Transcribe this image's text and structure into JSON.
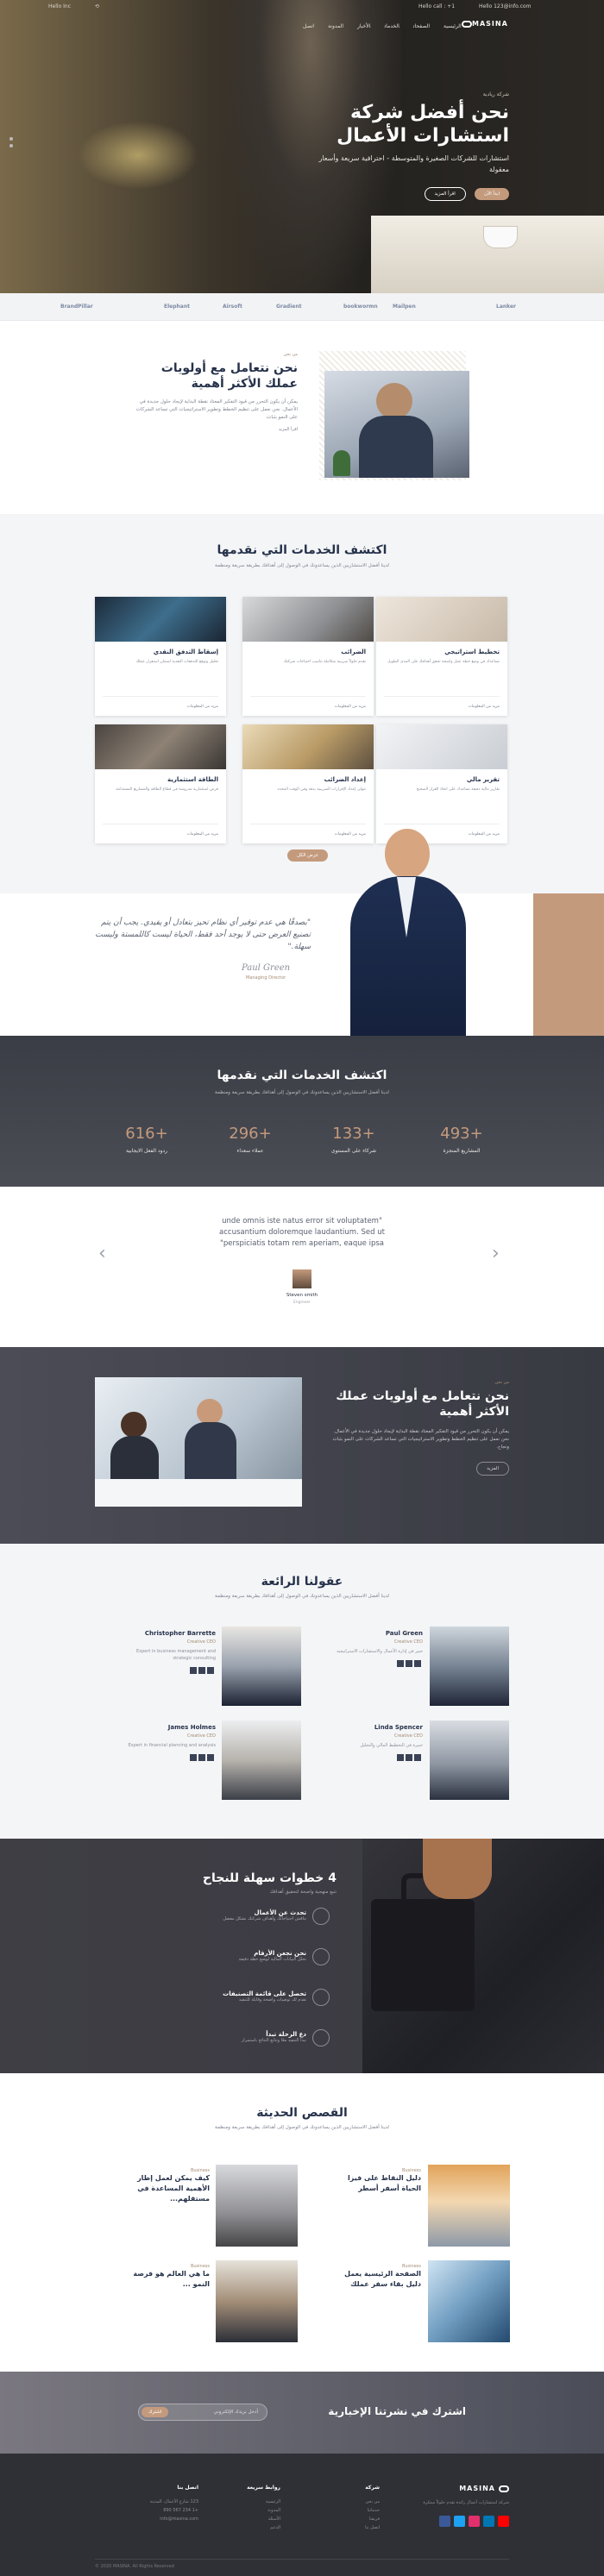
{
  "topbar": {
    "left_text": "Hello Inc",
    "phone": "Hello call : +1",
    "email": "Hello 123@info.com"
  },
  "nav": {
    "items": [
      "الرئيسية",
      "الصفحات",
      "الخدمات",
      "الأخبار",
      "المدونة",
      "اتصل"
    ]
  },
  "brand": {
    "name": "MASINA"
  },
  "hero": {
    "eyebrow": "شركة ريادية",
    "title": "نحن أفضل شركة استشارات الأعمال",
    "subtitle": "استشارات للشركات الصغيرة والمتوسطة - احترافية سريعة وأسعار معقولة",
    "btn_primary": "ابدأ الآن",
    "btn_secondary": "اقرأ المزيد"
  },
  "partners": [
    "BrandPillar",
    "Elephant",
    "Airsoft",
    "Gradient",
    "bookwormn",
    "Mailpen",
    "Lanker"
  ],
  "about": {
    "label": "من نحن",
    "title": "نحن نتعامل مع أولويات عملك الأكثر أهمية",
    "body": "يمكن أن يكون التحرر من قيود التفكير المعتاد نقطة البداية لإيجاد حلول جديدة في الأعمال. نحن نعمل على تنظيم الخطط وتطوير الاستراتيجيات التي تساعد الشركات على النمو بثبات.",
    "link": "اقرأ المزيد"
  },
  "services": {
    "title": "اكتشف الخدمات التي نقدمها",
    "intro": "لدينا أفضل الاستشاريين الذين يساعدونك في الوصول إلى أهدافك بطريقة سريعة ومنظمة",
    "cards": [
      {
        "title": "تخطيط استراتيجي",
        "desc": "نساعدك في وضع خطة عمل واضحة تحقق أهدافك على المدى الطويل",
        "more": "مزيد من المعلومات"
      },
      {
        "title": "الضرائب",
        "desc": "نقدم حلولاً ضريبية متكاملة تناسب احتياجات شركتك",
        "more": "مزيد من المعلومات"
      },
      {
        "title": "إسقاط التدفق النقدي",
        "desc": "تحليل وتوقع التدفقات النقدية لضمان استقرار عملك",
        "more": "مزيد من المعلومات"
      },
      {
        "title": "تقرير مالي",
        "desc": "تقارير مالية دقيقة تساعدك على اتخاذ القرار الصحيح",
        "more": "مزيد من المعلومات"
      },
      {
        "title": "إعداد الضرائب",
        "desc": "نتولى إعداد الإقرارات الضريبية بدقة وفي الوقت المحدد",
        "more": "مزيد من المعلومات"
      },
      {
        "title": "الطاقة استثمارية",
        "desc": "فرص استثمارية مدروسة في قطاع الطاقة والمشاريع المستدامة",
        "more": "مزيد من المعلومات"
      }
    ],
    "button": "عرض الكل"
  },
  "testimonial": {
    "quote": "\"بصدقًا هي عدم توفير أي نظام تحيز بتعادل أو يفيدي. يجب أن يتم تصنيع العرض حتى لا يوجد أحد فقط، الحياة ليست كاللمستة وليست سهلة.\"",
    "signature": "Paul Green",
    "role": "Managing Director"
  },
  "stats": {
    "title": "اكتشف الخدمات التي نقدمها",
    "intro": "لدينا أفضل الاستشاريين الذين يساعدونك في الوصول إلى أهدافك بطريقة سريعة ومنظمة",
    "items": [
      {
        "num": "493+",
        "label": "المشاريع المنجزة"
      },
      {
        "num": "133+",
        "label": "شركاء على المستوى"
      },
      {
        "num": "296+",
        "label": "عملاء سعداء"
      },
      {
        "num": "616+",
        "label": "ردود الفعل الايجابية"
      }
    ]
  },
  "quote": {
    "text": "unde omnis iste natus error sit voluptatem\" accusantium doloremque laudantium. Sed ut \"perspiciatis totam rem aperiam, eaque ipsa",
    "name": "Steven smith",
    "role": "Engineer"
  },
  "priorities": {
    "label": "من نحن",
    "title": "نحن نتعامل مع أولويات عملك الأكثر أهمية",
    "body": "يمكن أن يكون التحرر من قيود التفكير المعتاد نقطة البداية لإيجاد حلول جديدة في الأعمال. نحن نعمل على تنظيم الخطط وتطوير الاستراتيجيات التي تساعد الشركات على النمو بثبات ونجاح.",
    "button": "المزيد"
  },
  "team": {
    "title": "عقولنا الرائعة",
    "intro": "لدينا أفضل الاستشاريين الذين يساعدونك في الوصول إلى أهدافك بطريقة سريعة ومنظمة",
    "members": [
      {
        "name": "Paul Green",
        "role": "Creative CEO",
        "desc": "خبير في إدارة الأعمال والاستشارات الاستراتيجية"
      },
      {
        "name": "Christopher Barrette",
        "role": "Creative CEO",
        "desc": "Expert in business management and strategic consulting"
      },
      {
        "name": "Linda Spencer",
        "role": "Creative CEO",
        "desc": "خبيرة في التخطيط المالي والتحليل"
      },
      {
        "name": "James Holmes",
        "role": "Creative CEO",
        "desc": "Expert in financial planning and analysis"
      }
    ]
  },
  "steps": {
    "title": "4 خطوات سهلة للنجاح",
    "intro": "نتبع منهجية واضحة لتحقيق أهدافك",
    "items": [
      {
        "title": "تحدث عن الأعمال",
        "desc": "نناقش احتياجاتك وأهداف شركتك بشكل مفصل"
      },
      {
        "title": "نحن نجعن الأرقام",
        "desc": "نحلل البيانات المالية لوضع خطة دقيقة"
      },
      {
        "title": "تحصل على قائمة التصنيفات",
        "desc": "نقدم لك توصيات واضحة وقابلة للتنفيذ"
      },
      {
        "title": "دع الرحلة تبدأ",
        "desc": "نبدأ التنفيذ معًا ونتابع النتائج باستمرار"
      }
    ]
  },
  "blog": {
    "title": "القصص الحديثة",
    "intro": "لدينا أفضل الاستشاريين الذين يساعدونك في الوصول إلى أهدافك بطريقة سريعة ومنظمة",
    "posts": [
      {
        "cat": "Business",
        "title": "دليل النقاط على فيزا الحياة أسفر أسطر"
      },
      {
        "cat": "Business",
        "title": "كيف يمكن لعمل إطار الأهمية المساعدة في مستقلهم..."
      },
      {
        "cat": "Business",
        "title": "الصفحة الرئيسية يعمل دليل بقاء سفر عملك"
      },
      {
        "cat": "Business",
        "title": "ما هي العالم هو فرصة النمو ..."
      }
    ]
  },
  "newsletter": {
    "title": "اشترك في نشرتنا الإخبارية",
    "placeholder": "أدخل بريدك الإلكتروني",
    "button": "اشترك"
  },
  "footer": {
    "about": "شركة استشارات أعمال رائدة تقدم حلولاً مبتكرة",
    "col1_title": "شركة",
    "col1": [
      "من نحن",
      "خدماتنا",
      "فريقنا",
      "اتصل بنا"
    ],
    "col2_title": "روابط سريعة",
    "col2": [
      "الرئيسية",
      "المدونة",
      "الأسئلة",
      "الدعم"
    ],
    "col3_title": "اتصل بنا",
    "col3": [
      "123 شارع الأعمال، المدينة",
      "+1 234 567 890",
      "info@masina.com"
    ],
    "copyright": "© 2020 MASINA. All Rights Reserved"
  }
}
